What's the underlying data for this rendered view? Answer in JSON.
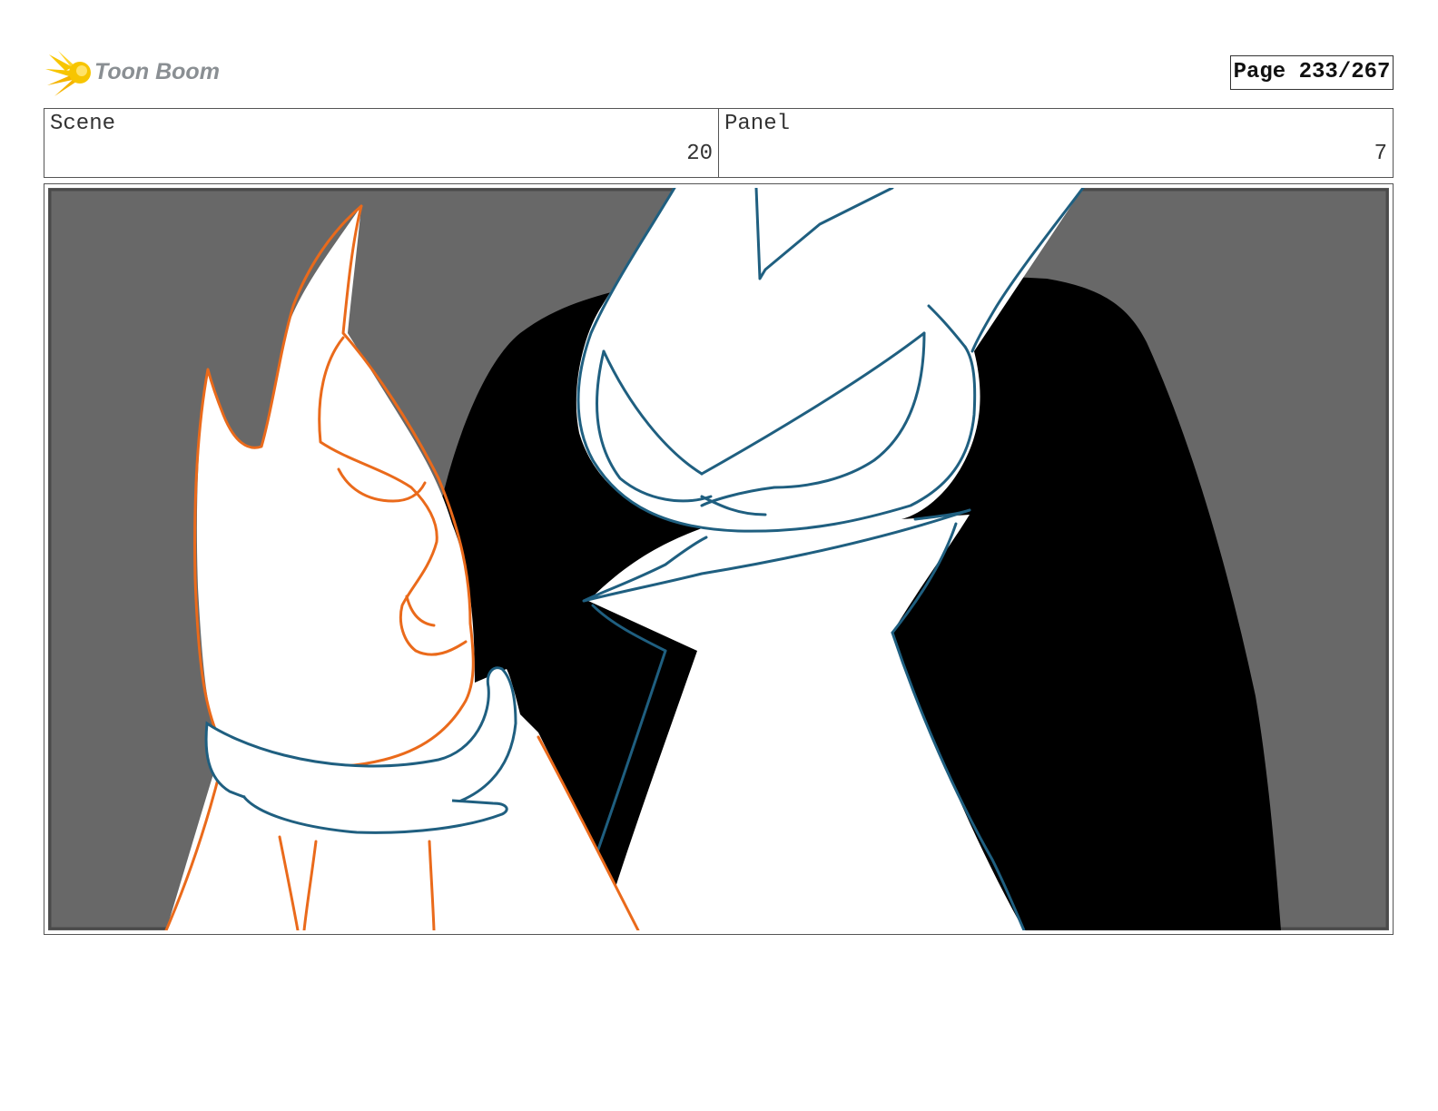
{
  "header": {
    "logo_text": "Toon Boom",
    "page_label": "Page 233/267"
  },
  "info": {
    "scene_label": "Scene",
    "scene_value": "20",
    "panel_label": "Panel",
    "panel_value": "7"
  },
  "icons": {
    "logo": "starburst-logo-icon"
  },
  "colors": {
    "background_gray": "#686868",
    "shape_black": "#000000",
    "outline_blue": "#1f5f80",
    "outline_orange": "#ea6a1b",
    "logo_yellow": "#f7c500"
  }
}
